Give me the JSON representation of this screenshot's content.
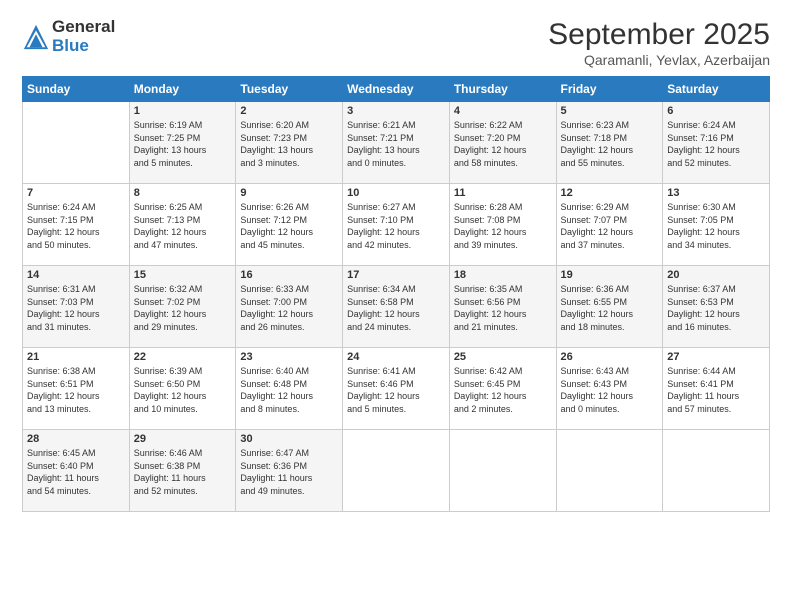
{
  "logo": {
    "general": "General",
    "blue": "Blue"
  },
  "header": {
    "month": "September 2025",
    "location": "Qaramanli, Yevlax, Azerbaijan"
  },
  "weekdays": [
    "Sunday",
    "Monday",
    "Tuesday",
    "Wednesday",
    "Thursday",
    "Friday",
    "Saturday"
  ],
  "weeks": [
    [
      {
        "day": "",
        "info": ""
      },
      {
        "day": "1",
        "info": "Sunrise: 6:19 AM\nSunset: 7:25 PM\nDaylight: 13 hours\nand 5 minutes."
      },
      {
        "day": "2",
        "info": "Sunrise: 6:20 AM\nSunset: 7:23 PM\nDaylight: 13 hours\nand 3 minutes."
      },
      {
        "day": "3",
        "info": "Sunrise: 6:21 AM\nSunset: 7:21 PM\nDaylight: 13 hours\nand 0 minutes."
      },
      {
        "day": "4",
        "info": "Sunrise: 6:22 AM\nSunset: 7:20 PM\nDaylight: 12 hours\nand 58 minutes."
      },
      {
        "day": "5",
        "info": "Sunrise: 6:23 AM\nSunset: 7:18 PM\nDaylight: 12 hours\nand 55 minutes."
      },
      {
        "day": "6",
        "info": "Sunrise: 6:24 AM\nSunset: 7:16 PM\nDaylight: 12 hours\nand 52 minutes."
      }
    ],
    [
      {
        "day": "7",
        "info": "Sunrise: 6:24 AM\nSunset: 7:15 PM\nDaylight: 12 hours\nand 50 minutes."
      },
      {
        "day": "8",
        "info": "Sunrise: 6:25 AM\nSunset: 7:13 PM\nDaylight: 12 hours\nand 47 minutes."
      },
      {
        "day": "9",
        "info": "Sunrise: 6:26 AM\nSunset: 7:12 PM\nDaylight: 12 hours\nand 45 minutes."
      },
      {
        "day": "10",
        "info": "Sunrise: 6:27 AM\nSunset: 7:10 PM\nDaylight: 12 hours\nand 42 minutes."
      },
      {
        "day": "11",
        "info": "Sunrise: 6:28 AM\nSunset: 7:08 PM\nDaylight: 12 hours\nand 39 minutes."
      },
      {
        "day": "12",
        "info": "Sunrise: 6:29 AM\nSunset: 7:07 PM\nDaylight: 12 hours\nand 37 minutes."
      },
      {
        "day": "13",
        "info": "Sunrise: 6:30 AM\nSunset: 7:05 PM\nDaylight: 12 hours\nand 34 minutes."
      }
    ],
    [
      {
        "day": "14",
        "info": "Sunrise: 6:31 AM\nSunset: 7:03 PM\nDaylight: 12 hours\nand 31 minutes."
      },
      {
        "day": "15",
        "info": "Sunrise: 6:32 AM\nSunset: 7:02 PM\nDaylight: 12 hours\nand 29 minutes."
      },
      {
        "day": "16",
        "info": "Sunrise: 6:33 AM\nSunset: 7:00 PM\nDaylight: 12 hours\nand 26 minutes."
      },
      {
        "day": "17",
        "info": "Sunrise: 6:34 AM\nSunset: 6:58 PM\nDaylight: 12 hours\nand 24 minutes."
      },
      {
        "day": "18",
        "info": "Sunrise: 6:35 AM\nSunset: 6:56 PM\nDaylight: 12 hours\nand 21 minutes."
      },
      {
        "day": "19",
        "info": "Sunrise: 6:36 AM\nSunset: 6:55 PM\nDaylight: 12 hours\nand 18 minutes."
      },
      {
        "day": "20",
        "info": "Sunrise: 6:37 AM\nSunset: 6:53 PM\nDaylight: 12 hours\nand 16 minutes."
      }
    ],
    [
      {
        "day": "21",
        "info": "Sunrise: 6:38 AM\nSunset: 6:51 PM\nDaylight: 12 hours\nand 13 minutes."
      },
      {
        "day": "22",
        "info": "Sunrise: 6:39 AM\nSunset: 6:50 PM\nDaylight: 12 hours\nand 10 minutes."
      },
      {
        "day": "23",
        "info": "Sunrise: 6:40 AM\nSunset: 6:48 PM\nDaylight: 12 hours\nand 8 minutes."
      },
      {
        "day": "24",
        "info": "Sunrise: 6:41 AM\nSunset: 6:46 PM\nDaylight: 12 hours\nand 5 minutes."
      },
      {
        "day": "25",
        "info": "Sunrise: 6:42 AM\nSunset: 6:45 PM\nDaylight: 12 hours\nand 2 minutes."
      },
      {
        "day": "26",
        "info": "Sunrise: 6:43 AM\nSunset: 6:43 PM\nDaylight: 12 hours\nand 0 minutes."
      },
      {
        "day": "27",
        "info": "Sunrise: 6:44 AM\nSunset: 6:41 PM\nDaylight: 11 hours\nand 57 minutes."
      }
    ],
    [
      {
        "day": "28",
        "info": "Sunrise: 6:45 AM\nSunset: 6:40 PM\nDaylight: 11 hours\nand 54 minutes."
      },
      {
        "day": "29",
        "info": "Sunrise: 6:46 AM\nSunset: 6:38 PM\nDaylight: 11 hours\nand 52 minutes."
      },
      {
        "day": "30",
        "info": "Sunrise: 6:47 AM\nSunset: 6:36 PM\nDaylight: 11 hours\nand 49 minutes."
      },
      {
        "day": "",
        "info": ""
      },
      {
        "day": "",
        "info": ""
      },
      {
        "day": "",
        "info": ""
      },
      {
        "day": "",
        "info": ""
      }
    ]
  ]
}
